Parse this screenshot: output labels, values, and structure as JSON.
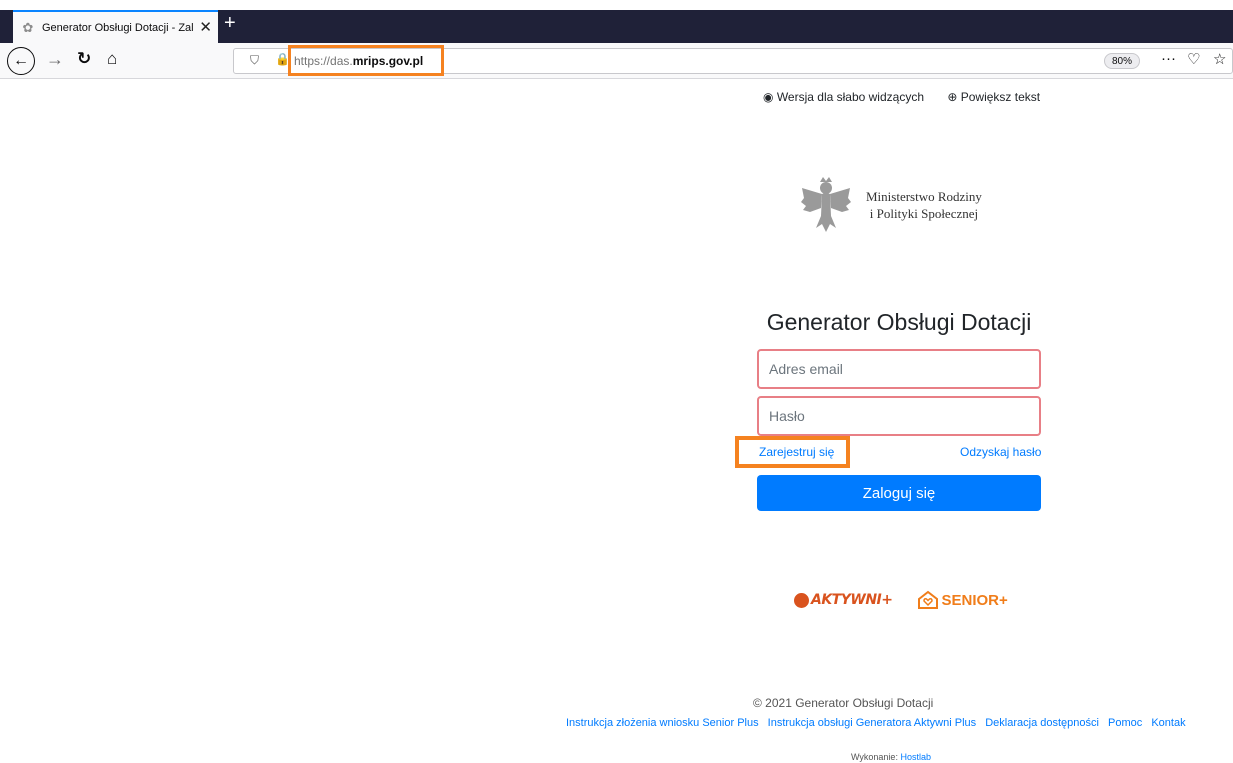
{
  "browser": {
    "tab_title": "Generator Obsługi Dotacji - Zal",
    "new_tab": "+",
    "url_prefix": "https://das.",
    "url_domain": "mrips.gov.pl",
    "zoom": "80%"
  },
  "page": {
    "accessibility_low_vision": "Wersja dla słabo widzących",
    "accessibility_enlarge": "Powiększ tekst",
    "ministry_line1": "Ministerstwo Rodziny",
    "ministry_line2": "i Polityki Społecznej",
    "title": "Generator Obsługi Dotacji",
    "email_placeholder": "Adres email",
    "password_placeholder": "Hasło",
    "register_link": "Zarejestruj się",
    "recover_link": "Odzyskaj hasło",
    "login_button": "Zaloguj się",
    "partner_aktywni": "AKTYWNI+",
    "partner_senior": "SENIOR+",
    "copyright": "© 2021 Generator Obsługi Dotacji",
    "footer_links": [
      "Instrukcja złożenia wniosku Senior Plus",
      "Instrukcja obsługi Generatora Aktywni Plus",
      "Deklaracja dostępności",
      "Pomoc",
      "Kontak"
    ],
    "made_by_label": "Wykonanie:",
    "made_by_name": "Hostlab"
  },
  "colors": {
    "highlight": "#f58220",
    "primary": "#007bff",
    "input_error_border": "#e87f86",
    "tabbar": "#1f2138"
  }
}
